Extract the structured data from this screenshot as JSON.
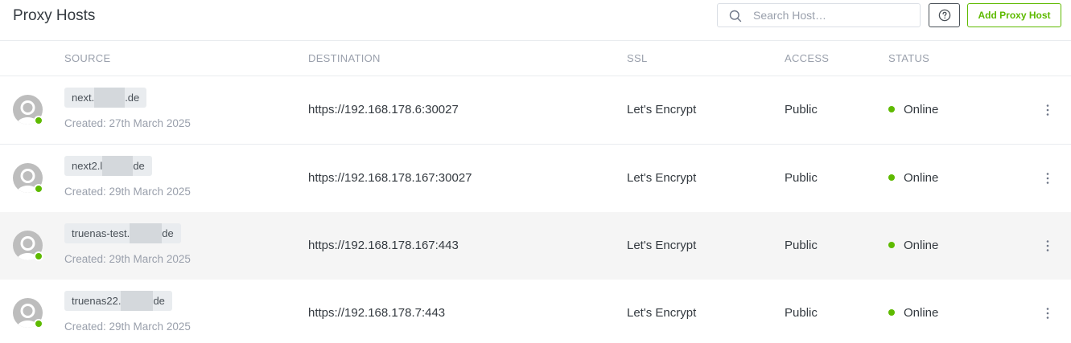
{
  "header": {
    "title": "Proxy Hosts",
    "search_placeholder": "Search Host…",
    "help_icon": "question-circle-icon",
    "add_label": "Add Proxy Host"
  },
  "colors": {
    "accent_green": "#5eba00",
    "tag_bg": "#e9ecef",
    "muted_text": "#9aa0ac"
  },
  "columns": {
    "source": "SOURCE",
    "destination": "DESTINATION",
    "ssl": "SSL",
    "access": "ACCESS",
    "status": "STATUS"
  },
  "rows": [
    {
      "source_prefix": "next.",
      "source_suffix": ".de",
      "created": "Created: 27th March 2025",
      "destination": "https://192.168.178.6:30027",
      "ssl": "Let's Encrypt",
      "access": "Public",
      "status": "Online"
    },
    {
      "source_prefix": "next2.l",
      "source_suffix": "de",
      "created": "Created: 29th March 2025",
      "destination": "https://192.168.178.167:30027",
      "ssl": "Let's Encrypt",
      "access": "Public",
      "status": "Online"
    },
    {
      "source_prefix": "truenas-test.",
      "source_suffix": "de",
      "created": "Created: 29th March 2025",
      "destination": "https://192.168.178.167:443",
      "ssl": "Let's Encrypt",
      "access": "Public",
      "status": "Online"
    },
    {
      "source_prefix": "truenas22.",
      "source_suffix": "de",
      "created": "Created: 29th March 2025",
      "destination": "https://192.168.178.7:443",
      "ssl": "Let's Encrypt",
      "access": "Public",
      "status": "Online"
    }
  ]
}
